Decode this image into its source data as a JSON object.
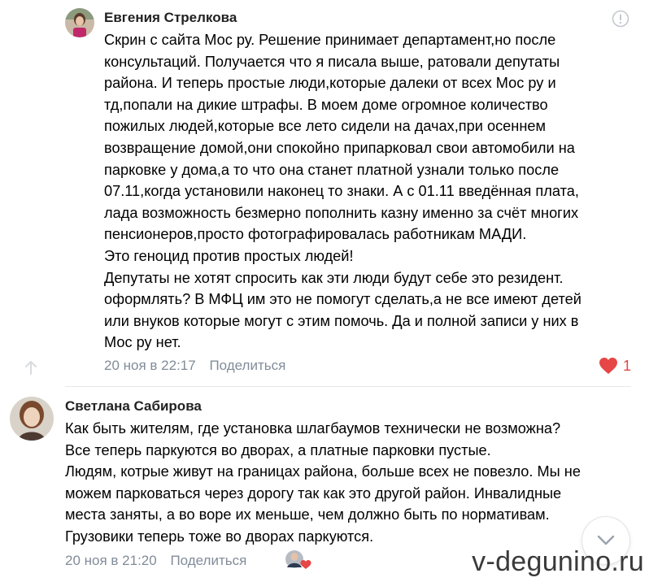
{
  "comments": [
    {
      "author": "Евгения Стрелкова",
      "lines": [
        "Скрин с сайта Мос ру. Решение принимает департамент,но после",
        "консультаций. Получается что я писала выше, ратовали депутаты",
        "района. И теперь простые люди,которые далеки от всех Мос ру и",
        "тд,попали на дикие штрафы. В моем доме огромное количество",
        "пожилых людей,которые все лето сидели на дачах,при осеннем",
        "возвращение домой,они спокойно припарковал свои автомобили на",
        "парковке у дома,а то что она станет платной узнали только после",
        "07.11,когда установили наконец то знаки. А с 01.11 введённая плата,",
        "лада возможность безмерно пополнить казну именно за счёт многих",
        "пенсионеров,просто фотографировалась работникам МАДИ.",
        "Это геноцид против простых людей!",
        "Депутаты не хотят спросить как эти люди будут себе это резидент.",
        "оформлять? В МФЦ им это не помогут сделать,а не все имеют детей",
        "или внуков которые могут с этим помочь. Да и полной записи у них в",
        "Мос ру нет."
      ],
      "date": "20 ноя в 22:17",
      "share_label": "Поделиться",
      "likes": "1"
    },
    {
      "author": "Светлана Сабирова",
      "lines": [
        "Как быть жителям, где установка шлагбаумов технически не возможна?",
        "Все теперь паркуются во дворах, а платные парковки пустые.",
        "Людям, котрые живут на границах района, больше всех не повезло. Мы не",
        "можем парковаться через дорогу так как это другой район. Инвалидные",
        "места заняты, а во воре их меньше, чем должно быть по нормативам.",
        "Грузовики теперь тоже во дворах паркуются."
      ],
      "date": "20 ноя в 21:20",
      "share_label": "Поделиться"
    }
  ],
  "watermark": "v-degunino.ru",
  "colors": {
    "meta": "#818c99",
    "like": "#e64646",
    "divider": "#e7e8ec"
  },
  "icons": [
    "report-icon",
    "arrow-up-icon",
    "heart-icon",
    "chevron-down-icon"
  ]
}
